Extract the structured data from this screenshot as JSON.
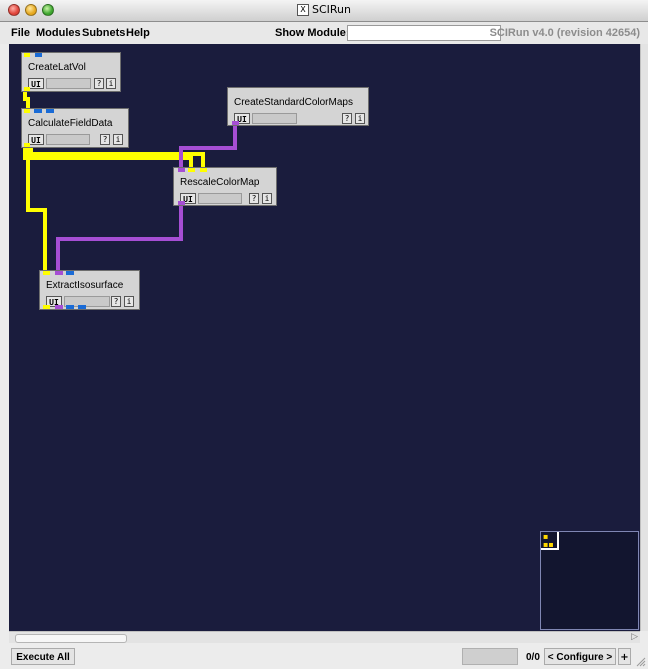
{
  "window": {
    "title": "SCIRun",
    "x_glyph": "X"
  },
  "menu": {
    "items": [
      "File",
      "Modules",
      "Subnets",
      "Help"
    ],
    "show_module_label": "Show Module:",
    "show_module_value": "",
    "version": "SCIRun v4.0 (revision 42654)"
  },
  "modules": [
    {
      "name": "CreateLatVol",
      "ui": "UI",
      "help": "?",
      "info": "i"
    },
    {
      "name": "CalculateFieldData",
      "ui": "UI",
      "help": "?",
      "info": "i"
    },
    {
      "name": "CreateStandardColorMaps",
      "ui": "UI",
      "help": "?",
      "info": "i"
    },
    {
      "name": "RescaleColorMap",
      "ui": "UI",
      "help": "?",
      "info": "i"
    },
    {
      "name": "ExtractIsosurface",
      "ui": "UI",
      "help": "?",
      "info": "i"
    }
  ],
  "connections": [
    {
      "from": "CreateLatVol",
      "to": "CalculateFieldData",
      "type": "field",
      "color": "#ffff00"
    },
    {
      "from": "CalculateFieldData",
      "to": "RescaleColorMap",
      "type": "field",
      "color": "#ffff00"
    },
    {
      "from": "CalculateFieldData",
      "to": "ExtractIsosurface",
      "type": "field",
      "color": "#ffff00"
    },
    {
      "from": "CreateStandardColorMaps",
      "to": "RescaleColorMap",
      "type": "colormap",
      "color": "#a64ed4"
    },
    {
      "from": "RescaleColorMap",
      "to": "ExtractIsosurface",
      "type": "colormap",
      "color": "#a64ed4"
    }
  ],
  "colors": {
    "canvas": "#1a1c3d",
    "field_port": "#ffff00",
    "matrix_port": "#1a6bd6",
    "colormap_port": "#a64ed4",
    "geometry_port": "#1a6bd6"
  },
  "status": {
    "execute_all": "Execute All",
    "counter": "0/0",
    "configure": "< Configure >",
    "plus": "+"
  }
}
